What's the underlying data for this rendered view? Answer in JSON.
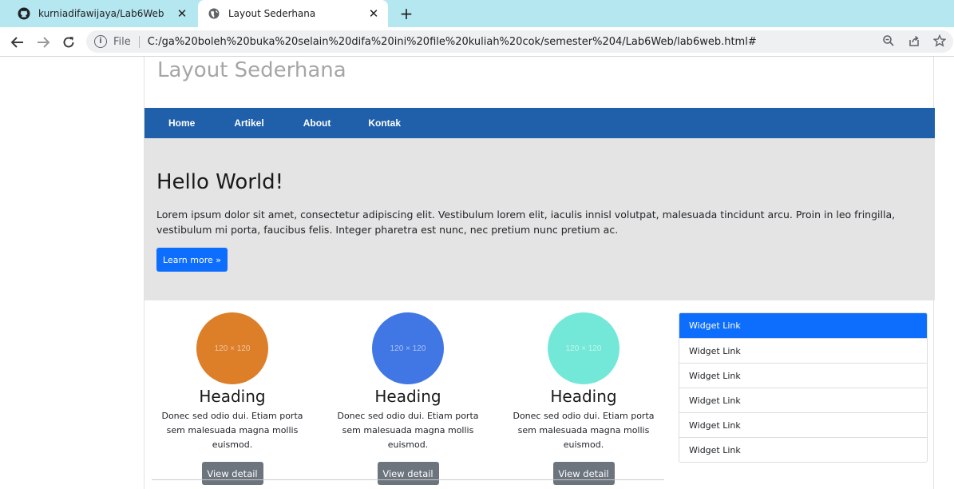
{
  "browser": {
    "tabs": [
      {
        "title": "kurniadifawijaya/Lab6Web",
        "icon": "github-icon",
        "active": false
      },
      {
        "title": "Layout Sederhana",
        "icon": "globe-icon",
        "active": true
      }
    ],
    "new_tab": "+",
    "file_label": "File",
    "url": "C:/ga%20boleh%20buka%20selain%20difa%20ini%20file%20kuliah%20cok/semester%204/Lab6Web/lab6web.html#"
  },
  "site": {
    "title": "Layout Sederhana"
  },
  "nav": {
    "items": [
      {
        "label": "Home"
      },
      {
        "label": "Artikel"
      },
      {
        "label": "About"
      },
      {
        "label": "Kontak"
      }
    ]
  },
  "hero": {
    "heading": "Hello World!",
    "text": "Lorem ipsum dolor sit amet, consectetur adipiscing elit. Vestibulum lorem elit, iaculis innisl volutpat, malesuada tincidunt arcu. Proin in leo fringilla, vestibulum mi porta, faucibus felis. Integer pharetra est nunc, nec pretium nunc pretium ac.",
    "button": "Learn more »"
  },
  "cards": [
    {
      "placeholder": "120 × 120",
      "color": "#dd7e28",
      "heading": "Heading",
      "text": "Donec sed odio dui. Etiam porta sem malesuada magna mollis euismod.",
      "button": "View detail"
    },
    {
      "placeholder": "120 × 120",
      "color": "#4176e5",
      "heading": "Heading",
      "text": "Donec sed odio dui. Etiam porta sem malesuada magna mollis euismod.",
      "button": "View detail"
    },
    {
      "placeholder": "120 × 120",
      "color": "#74e8d8",
      "heading": "Heading",
      "text": "Donec sed odio dui. Etiam porta sem malesuada magna mollis euismod.",
      "button": "View detail"
    }
  ],
  "widget": {
    "links": [
      {
        "label": "Widget Link"
      },
      {
        "label": "Widget Link"
      },
      {
        "label": "Widget Link"
      },
      {
        "label": "Widget Link"
      },
      {
        "label": "Widget Link"
      },
      {
        "label": "Widget Link"
      }
    ]
  },
  "colors": {
    "nav_bg": "#2060ab",
    "primary": "#0d6efd",
    "secondary": "#6c757d",
    "hero_bg": "#e4e4e4",
    "tabbar_bg": "#b5e7f0"
  }
}
